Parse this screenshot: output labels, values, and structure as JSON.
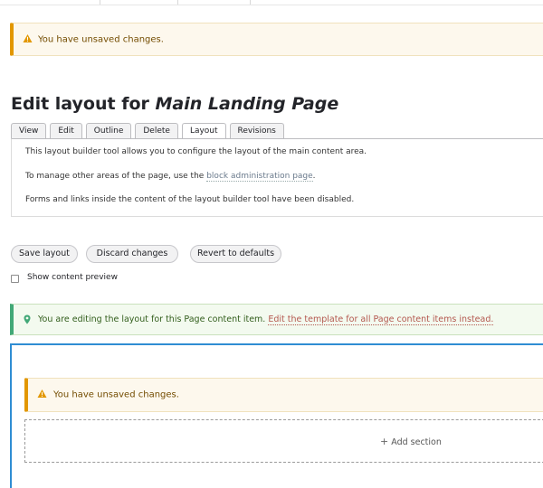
{
  "messages": {
    "unsaved_top": "You have unsaved changes.",
    "unsaved_builder": "You have unsaved changes."
  },
  "page": {
    "title_prefix": "Edit layout for",
    "title_entity": "Main Landing Page"
  },
  "tabs": [
    {
      "label": "View"
    },
    {
      "label": "Edit"
    },
    {
      "label": "Outline"
    },
    {
      "label": "Delete"
    },
    {
      "label": "Layout",
      "active": true
    },
    {
      "label": "Revisions"
    }
  ],
  "info": {
    "line1": "This layout builder tool allows you to configure the layout of the main content area.",
    "line2_prefix": "To manage other areas of the page, use the",
    "line2_link": "block administration page",
    "line2_suffix": ".",
    "line3": "Forms and links inside the content of the layout builder tool have been disabled."
  },
  "actions": {
    "save": "Save layout",
    "discard": "Discard changes",
    "revert": "Revert to defaults"
  },
  "preview": {
    "label": "Show content preview",
    "checked": false
  },
  "status": {
    "text": "You are editing the layout for this Page content item.",
    "link": "Edit the template for all Page content items instead."
  },
  "builder": {
    "add_section": "Add section"
  },
  "colors": {
    "warning_accent": "#e29700",
    "status_accent": "#42a877",
    "builder_outline": "#2f8dd3"
  },
  "icons": {
    "warning": "warning-triangle-icon",
    "status": "map-pin-icon",
    "add": "plus-icon"
  }
}
